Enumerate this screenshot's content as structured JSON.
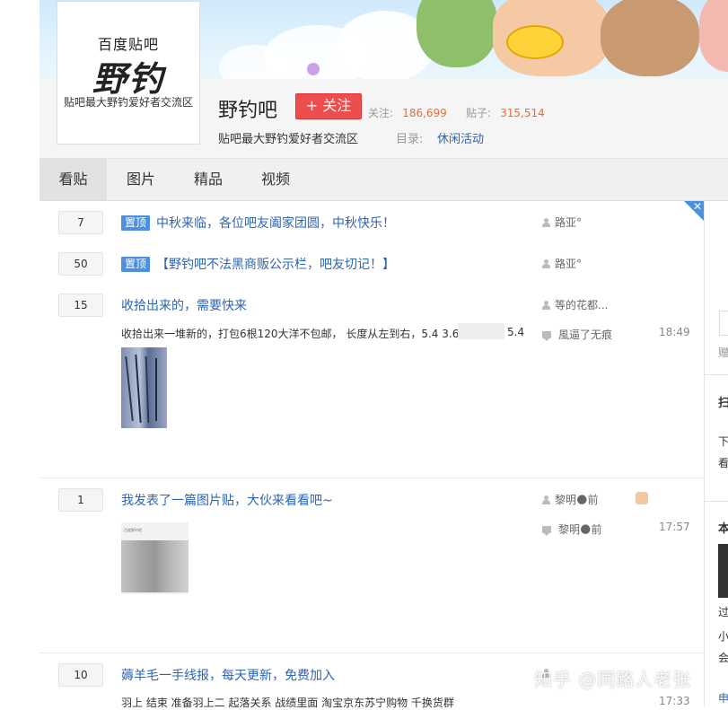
{
  "forum": {
    "logo_top": "百度贴吧",
    "logo_main": "野钓",
    "logo_sub": "贴吧最大野钓爱好者交流区",
    "name": "野钓吧",
    "follow_label": "+ 关注",
    "followers_label": "关注:",
    "followers_value": "186,699",
    "posts_label": "贴子:",
    "posts_value": "315,514",
    "slogan": "贴吧最大野钓爱好者交流区",
    "directory_label": "目录:",
    "directory_value": "休闲活动"
  },
  "tabs": [
    {
      "label": "看贴",
      "active": true
    },
    {
      "label": "图片",
      "active": false
    },
    {
      "label": "精品",
      "active": false
    },
    {
      "label": "视频",
      "active": false
    }
  ],
  "sticky_badge": "置顶",
  "threads": [
    {
      "replies": "7",
      "sticky": true,
      "title": "中秋来临，各位吧友阖家团圆，中秋快乐！",
      "author": "路亚°"
    },
    {
      "replies": "50",
      "sticky": true,
      "title": "【野钓吧不法黑商贩公示栏，吧友切记！】",
      "author": "路亚°"
    },
    {
      "replies": "15",
      "sticky": false,
      "title": "收拾出来的，需要快来",
      "author": "等的花都...",
      "excerpt": "收拾出来一堆新的，打包6根120大洋不包邮， 长度从左到右，5.4 3.6 4",
      "excerpt_end": "5.4",
      "last_reply": "風逼了无痕",
      "time": "18:49"
    },
    {
      "replies": "1",
      "sticky": false,
      "title": "我发表了一篇图片贴，大伙来看看吧~",
      "author": "黎明🌑前",
      "last_reply": "黎明🌑前",
      "time": "17:57",
      "thumb_caption": "百度野钓吧"
    },
    {
      "replies": "10",
      "sticky": false,
      "title": "薅羊毛一手线报，每天更新，免费加入",
      "author": "",
      "excerpt": "羽上 结束 准备羽上二 起落关系 战绩里面 淘宝京东苏宁购物 千换货群",
      "time": "17:33"
    }
  ],
  "right_panel": {
    "chars": [
      "赠",
      "扫",
      "下",
      "看",
      "本",
      "过",
      "小",
      "会",
      "申"
    ]
  },
  "watermark": "知乎 @同路人老张",
  "colors": {
    "link": "#2d64b3",
    "sticky": "#4e90e0",
    "follow": "#ee4d4d",
    "stat": "#ec6a3a"
  }
}
